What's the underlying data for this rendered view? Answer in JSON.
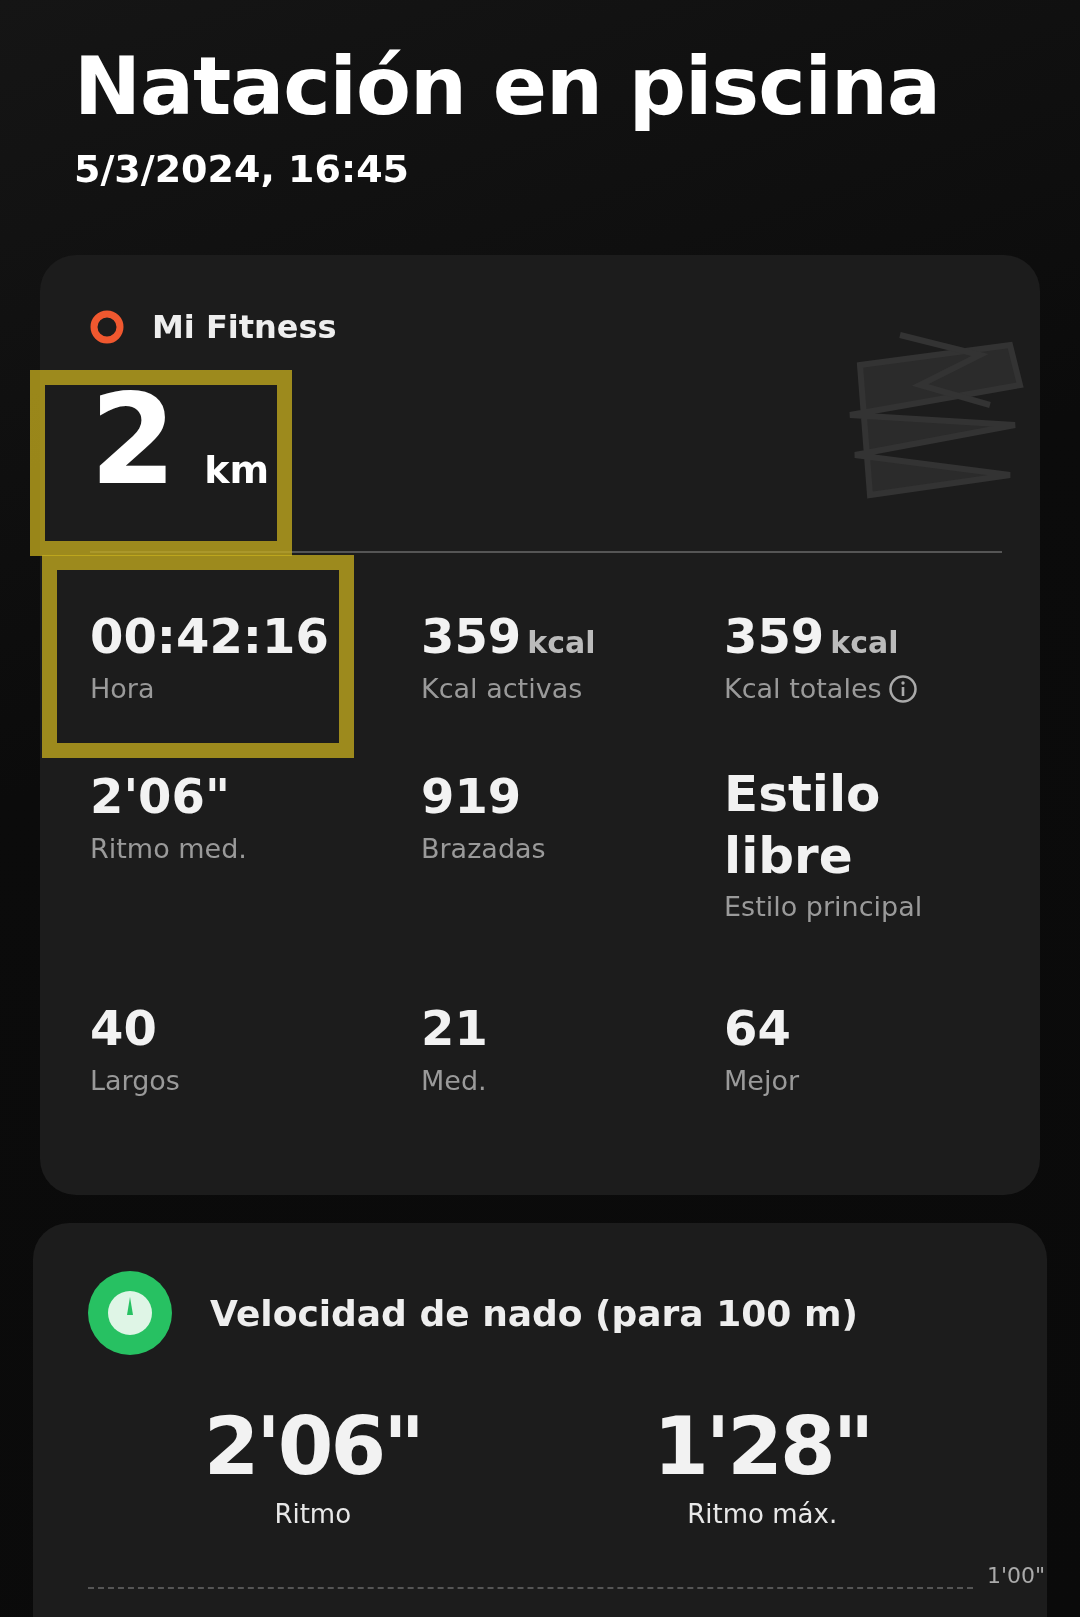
{
  "header": {
    "title": "Natación en piscina",
    "datetime": "5/3/2024, 16:45"
  },
  "summary": {
    "source": "Mi Fitness",
    "distance": {
      "value": "2",
      "unit": "km"
    },
    "stats": [
      {
        "value": "00:42:16",
        "label": "Hora"
      },
      {
        "value": "359",
        "unit": "kcal",
        "label": "Kcal activas"
      },
      {
        "value": "359",
        "unit": "kcal",
        "label": "Kcal totales",
        "info": true
      },
      {
        "value": "2'06\"",
        "label": "Ritmo med."
      },
      {
        "value": "919",
        "label": "Brazadas"
      },
      {
        "value": "Estilo libre",
        "label": "Estilo principal",
        "kind": "text"
      },
      {
        "value": "40",
        "label": "Largos"
      },
      {
        "value": "21",
        "label": "Med."
      },
      {
        "value": "64",
        "label": "Mejor"
      }
    ]
  },
  "pace": {
    "title": "Velocidad de nado (para 100 m)",
    "metrics": [
      {
        "value": "2'06\"",
        "label": "Ritmo"
      },
      {
        "value": "1'28\"",
        "label": "Ritmo máx."
      }
    ],
    "chart_tick": "1'00\""
  }
}
